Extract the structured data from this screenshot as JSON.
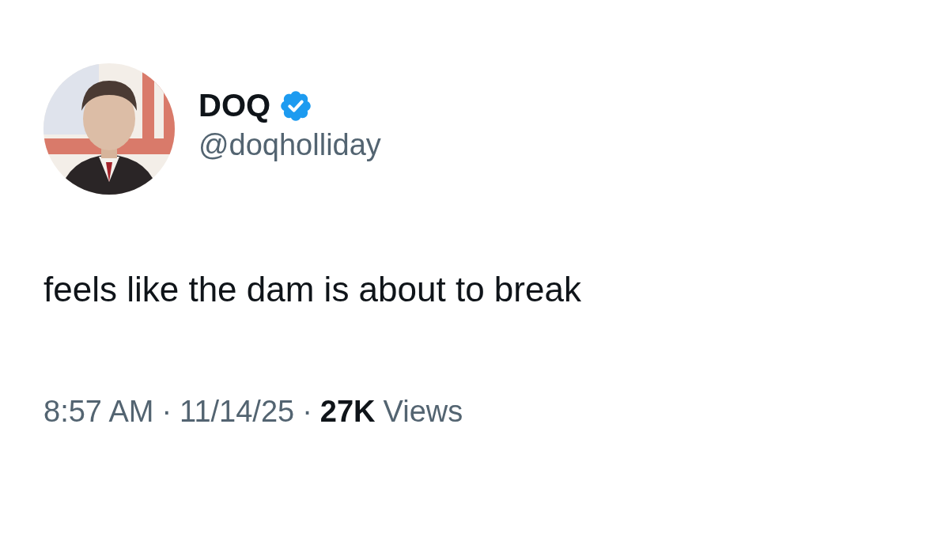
{
  "author": {
    "name": "DOQ",
    "verified": true,
    "handle": "@doqholliday"
  },
  "text": "feels like the dam is about to break",
  "meta": {
    "time": "8:57 AM",
    "separator_1": "·",
    "date": "11/14/25",
    "separator_2": "·",
    "views_count": "27K",
    "views_label": "Views"
  }
}
